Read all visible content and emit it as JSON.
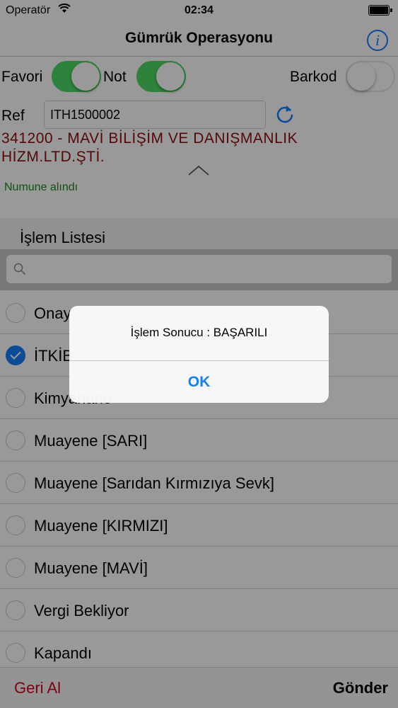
{
  "status_bar": {
    "carrier": "Operatör",
    "time": "02:34"
  },
  "nav": {
    "title": "Gümrük Operasyonu",
    "info_icon_text": "i"
  },
  "toggles": {
    "favori": {
      "label": "Favori",
      "on": true
    },
    "not": {
      "label": "Not",
      "on": true
    },
    "barkod": {
      "label": "Barkod",
      "on": false
    }
  },
  "ref": {
    "label": "Ref",
    "value": "ITH1500002"
  },
  "company": {
    "line1": "341200 - MAVİ BİLİŞİM VE DANIŞMANLIK",
    "line2": "HİZM.LTD.ŞTİ."
  },
  "status_note": "Numune alındı",
  "list": {
    "header": "İşlem Listesi",
    "items": [
      {
        "label": "Onay",
        "checked": false
      },
      {
        "label": "İTKİB",
        "checked": true
      },
      {
        "label": "Kimyahane",
        "checked": false
      },
      {
        "label": "Muayene [SARI]",
        "checked": false
      },
      {
        "label": "Muayene [Sarıdan Kırmızıya Sevk]",
        "checked": false
      },
      {
        "label": "Muayene [KIRMIZI]",
        "checked": false
      },
      {
        "label": "Muayene [MAVİ]",
        "checked": false
      },
      {
        "label": "Vergi Bekliyor",
        "checked": false
      },
      {
        "label": "Kapandı",
        "checked": false
      }
    ]
  },
  "toolbar": {
    "back_label": "Geri Al",
    "send_label": "Gönder"
  },
  "alert": {
    "message": "İşlem Sonucu : BAŞARILI",
    "ok_label": "OK"
  },
  "colors": {
    "accent": "#147efb",
    "toggle_on": "#4cd964",
    "company_text": "#8b0e0e",
    "note_text": "#1a8a1a",
    "back_button": "#d0021b"
  }
}
